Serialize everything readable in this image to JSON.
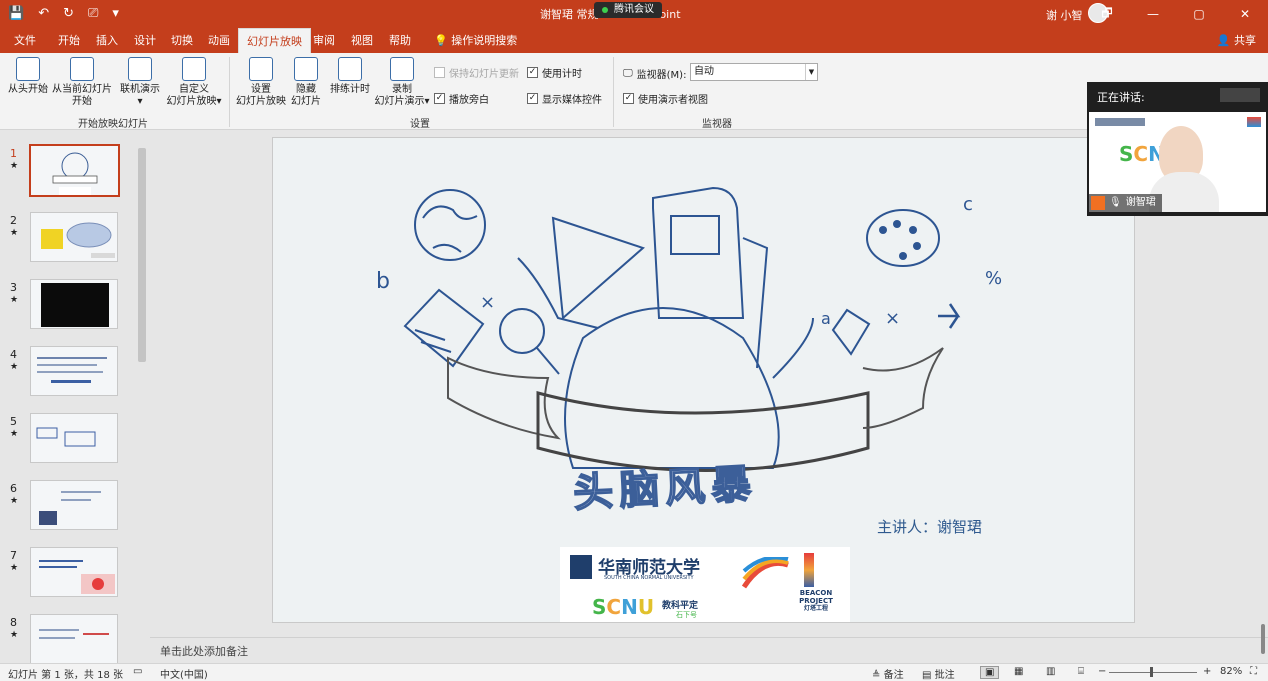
{
  "window": {
    "title": "谢智珺 常规... - PowerPoint",
    "meeting_chip": "腾讯会议",
    "user": "谢 小智",
    "controls": [
      "🗗",
      "—",
      "▢",
      "✕"
    ]
  },
  "qat": [
    "💾",
    "↶",
    "↻",
    "⎚",
    "▾"
  ],
  "tabs": [
    "文件",
    "开始",
    "插入",
    "设计",
    "切换",
    "动画",
    "幻灯片放映",
    "审阅",
    "视图",
    "帮助"
  ],
  "tell_me": "操作说明搜索",
  "share": "共享",
  "ribbon": {
    "group1": {
      "label": "开始放映幻灯片",
      "buttons": [
        {
          "l1": "从头开始",
          "l2": ""
        },
        {
          "l1": "从当前幻灯片",
          "l2": "开始"
        },
        {
          "l1": "联机演示",
          "l2": "▾"
        },
        {
          "l1": "自定义",
          "l2": "幻灯片放映▾"
        }
      ]
    },
    "group2": {
      "label": "设置",
      "buttons": [
        {
          "l1": "设置",
          "l2": "幻灯片放映"
        },
        {
          "l1": "隐藏",
          "l2": "幻灯片"
        },
        {
          "l1": "排练计时",
          "l2": ""
        },
        {
          "l1": "录制",
          "l2": "幻灯片演示▾"
        }
      ],
      "checks": [
        {
          "label": "保持幻灯片更新",
          "checked": false,
          "disabled": true
        },
        {
          "label": "使用计时",
          "checked": true,
          "disabled": false
        },
        {
          "label": "播放旁白",
          "checked": true,
          "disabled": false
        },
        {
          "label": "显示媒体控件",
          "checked": true,
          "disabled": false
        }
      ]
    },
    "group3": {
      "label": "监视器",
      "monitor_label": "监视器(M):",
      "monitor_value": "自动",
      "presenter_view": "使用演示者视图"
    }
  },
  "slides": [
    {
      "num": "1"
    },
    {
      "num": "2"
    },
    {
      "num": "3"
    },
    {
      "num": "4"
    },
    {
      "num": "5"
    },
    {
      "num": "6"
    },
    {
      "num": "7"
    },
    {
      "num": "8"
    }
  ],
  "current_slide": {
    "title": "头脑风暴",
    "speaker": "主讲人：谢智珺",
    "logo_text_top": "华南师范大学",
    "logo_sub": "SOUTH CHINA NORMAL UNIVERSITY",
    "logo_text_bottom": "教科平定",
    "logo_sub2": "石下号",
    "beacon1": "BEACON",
    "beacon2": "PROJECT",
    "beacon3": "灯塔工程"
  },
  "notes_placeholder": "单击此处添加备注",
  "status": {
    "slide_info": "幻灯片 第 1 张，共 18 张",
    "language": "中文(中国)",
    "notes": "备注",
    "comments": "批注",
    "zoom": "82%"
  },
  "video": {
    "header": "正在讲话:",
    "name": "谢智珺"
  }
}
